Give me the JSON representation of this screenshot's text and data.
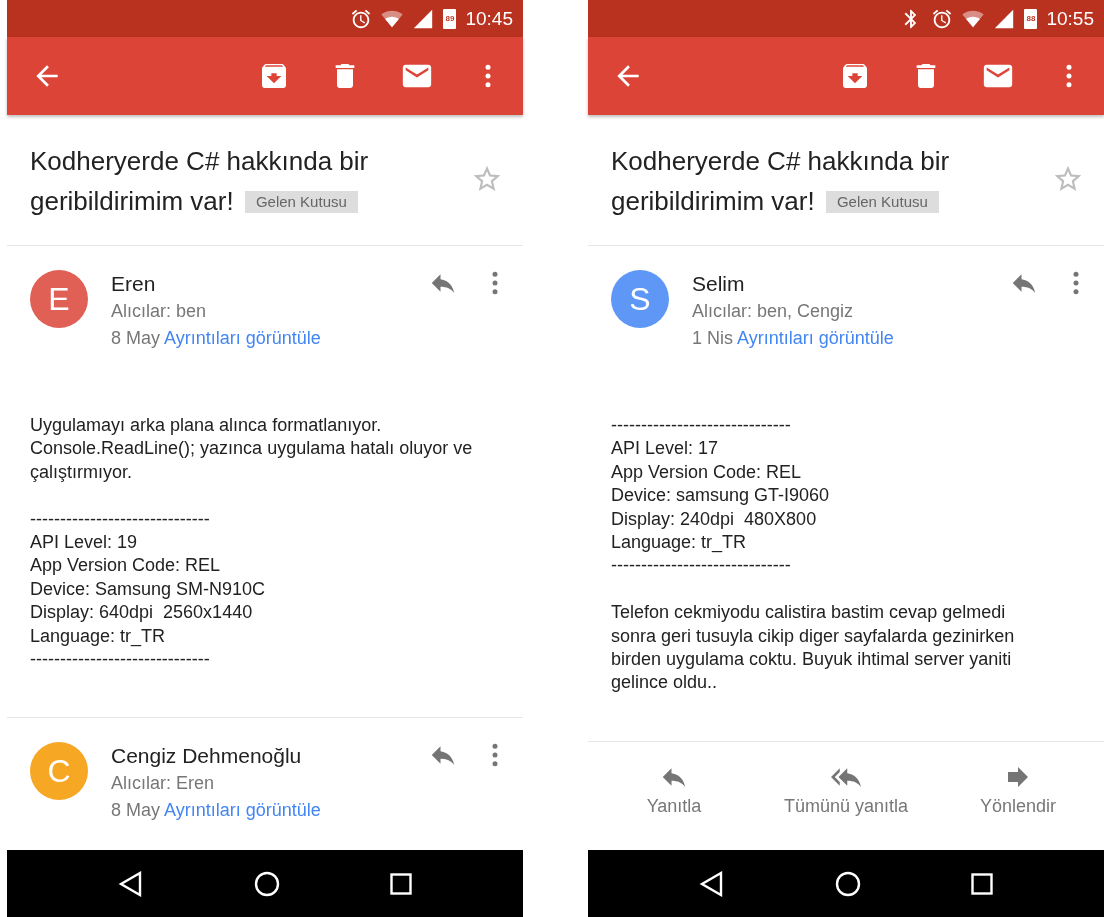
{
  "phones": [
    {
      "status_bar": {
        "icons": [
          {
            "kind": "alarm"
          },
          {
            "kind": "wifi"
          },
          {
            "kind": "signal"
          },
          {
            "kind": "battery",
            "text": "89"
          }
        ],
        "time": "10:45"
      },
      "subject": "Kodheryerde C# hakkında bir geribildirimim var!",
      "label": "Gelen Kutusu",
      "starred": false,
      "messages": [
        {
          "avatar_letter": "E",
          "color": "#e06055",
          "sender": "Eren",
          "recipients": "Alıcılar: ben",
          "date": "8 May",
          "details_link": "Ayrıntıları görüntüle",
          "body": [
            [
              "Uygulamayı arka plana alınca formatlanıyor.",
              "Console.ReadLine(); yazınca uygulama hatalı oluyor ve",
              "çalıştırmıyor."
            ],
            [
              "------------------------------",
              "API Level: 19",
              "App Version Code: REL",
              "Device: Samsung SM-N910C",
              "Display: 640dpi  2560x1440",
              "Language: tr_TR",
              "------------------------------"
            ]
          ]
        },
        {
          "avatar_letter": "C",
          "color": "#f6a723",
          "sender": "Cengiz Dehmenoğlu",
          "recipients": "Alıcılar: Eren",
          "date": "8 May",
          "details_link": "Ayrıntıları görüntüle"
        }
      ]
    },
    {
      "status_bar": {
        "icons": [
          {
            "kind": "bluetooth"
          },
          {
            "kind": "alarm"
          },
          {
            "kind": "wifi"
          },
          {
            "kind": "signal"
          },
          {
            "kind": "battery",
            "text": "88"
          }
        ],
        "time": "10:55"
      },
      "subject": "Kodheryerde C# hakkında bir geribildirimim var!",
      "label": "Gelen Kutusu",
      "starred": false,
      "messages": [
        {
          "avatar_letter": "S",
          "color": "#5e97f6",
          "sender": "Selim",
          "recipients": "Alıcılar: ben, Cengiz",
          "date": "1 Nis",
          "details_link": "Ayrıntıları görüntüle",
          "body": [
            [
              "------------------------------",
              "API Level: 17",
              "App Version Code: REL",
              "Device: samsung GT-I9060",
              "Display: 240dpi  480X800",
              "Language: tr_TR",
              "------------------------------"
            ],
            [
              "Telefon cekmiyodu calistira bastim cevap gelmedi",
              "sonra geri tusuyla cikip diger sayfalarda gezinirken",
              "birden uygulama coktu. Buyuk ihtimal server yaniti",
              "gelince oldu.."
            ]
          ]
        }
      ],
      "actions": [
        {
          "kind": "reply",
          "label": "Yanıtla"
        },
        {
          "kind": "reply_all",
          "label": "Tümünü yanıtla"
        },
        {
          "kind": "forward",
          "label": "Yönlendir"
        }
      ]
    }
  ]
}
